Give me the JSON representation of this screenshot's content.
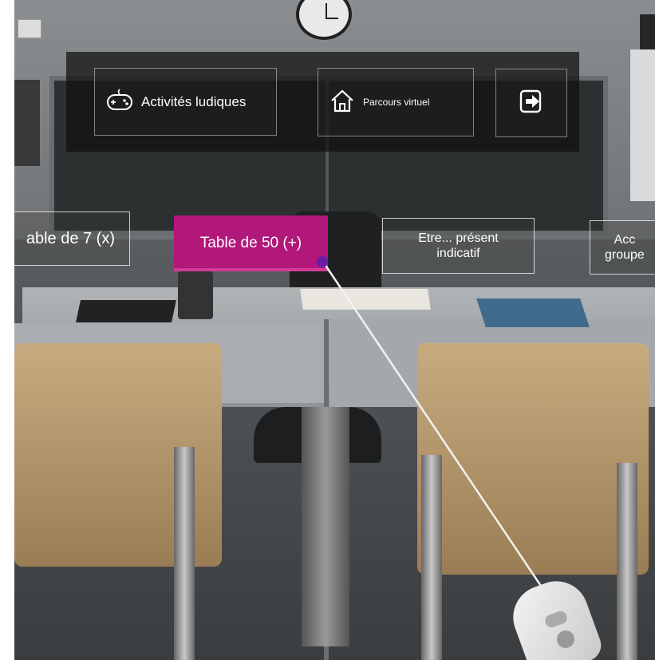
{
  "menu": {
    "activites_label": "Activités ludiques",
    "activites_icon": "gamepad-icon",
    "parcours_label": "Parcours virtuel",
    "parcours_icon": "home-icon",
    "exit_icon": "exit-icon"
  },
  "cards": {
    "table7": "able de 7 (x)",
    "table50": "Table de 50 (+)",
    "etre_line1": "Etre... présent",
    "etre_line2": "indicatif",
    "acc_line1": "Acc",
    "acc_line2": "groupe"
  },
  "colors": {
    "selected_card": "#b1187a",
    "pointer_dot": "#6a1ca8",
    "menu_bar": "rgba(15,15,15,0.72)"
  }
}
